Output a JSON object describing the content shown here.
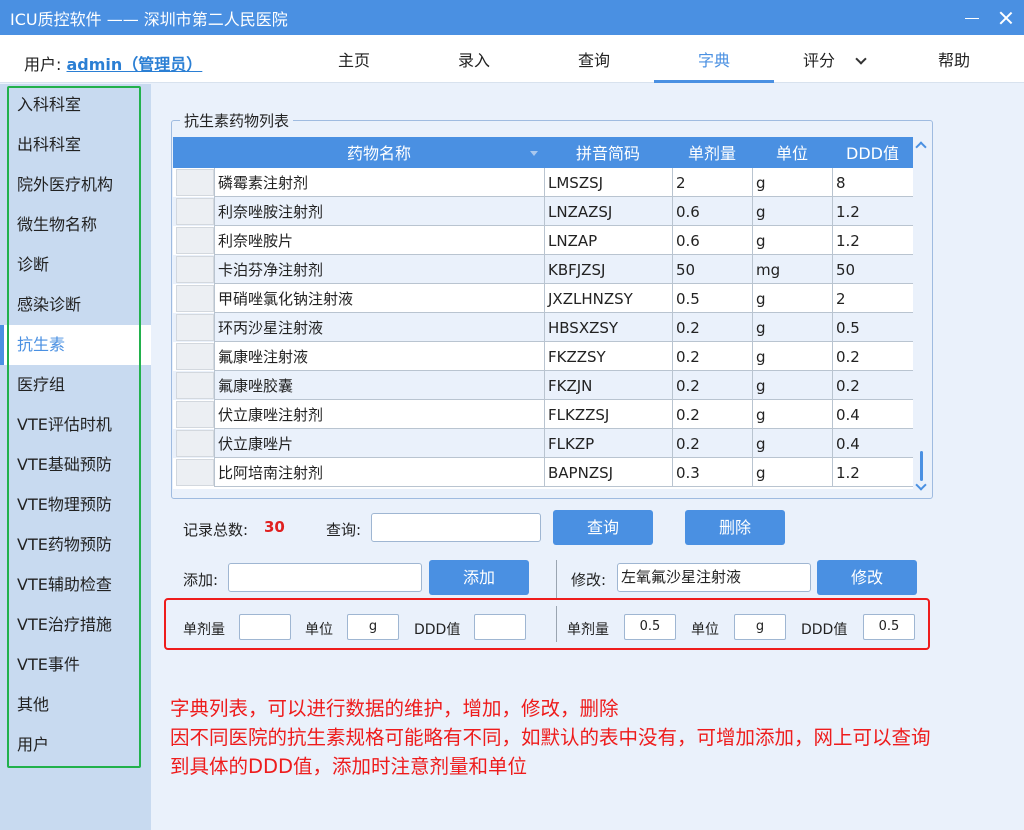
{
  "titlebar": {
    "title": "ICU质控软件 —— 深圳市第二人民医院"
  },
  "menubar": {
    "user_prefix": "用户:",
    "user_name": "admin（管理员）",
    "items": [
      {
        "label": "主页"
      },
      {
        "label": "录入"
      },
      {
        "label": "查询"
      },
      {
        "label": "字典"
      },
      {
        "label": "评分"
      },
      {
        "label": "帮助"
      }
    ],
    "active": "字典"
  },
  "sidebar": {
    "items": [
      {
        "label": "入科科室"
      },
      {
        "label": "出科科室"
      },
      {
        "label": "院外医疗机构"
      },
      {
        "label": "微生物名称"
      },
      {
        "label": "诊断"
      },
      {
        "label": "感染诊断"
      },
      {
        "label": "抗生素"
      },
      {
        "label": "医疗组"
      },
      {
        "label": "VTE评估时机"
      },
      {
        "label": "VTE基础预防"
      },
      {
        "label": "VTE物理预防"
      },
      {
        "label": "VTE药物预防"
      },
      {
        "label": "VTE辅助检查"
      },
      {
        "label": "VTE治疗措施"
      },
      {
        "label": "VTE事件"
      },
      {
        "label": "其他"
      },
      {
        "label": "用户"
      }
    ],
    "active": "抗生素",
    "frame_color": "#22b14c"
  },
  "group": {
    "title": "抗生素药物列表"
  },
  "table": {
    "columns": [
      "药物名称",
      "拼音简码",
      "单剂量",
      "单位",
      "DDD值"
    ],
    "rows": [
      [
        "磷霉素注射剂",
        "LMSZSJ",
        "2",
        "g",
        "8"
      ],
      [
        "利奈唑胺注射剂",
        "LNZAZSJ",
        "0.6",
        "g",
        "1.2"
      ],
      [
        "利奈唑胺片",
        "LNZAP",
        "0.6",
        "g",
        "1.2"
      ],
      [
        "卡泊芬净注射剂",
        "KBFJZSJ",
        "50",
        "mg",
        "50"
      ],
      [
        "甲硝唑氯化钠注射液",
        "JXZLHNZSY",
        "0.5",
        "g",
        "2"
      ],
      [
        "环丙沙星注射液",
        "HBSXZSY",
        "0.2",
        "g",
        "0.5"
      ],
      [
        "氟康唑注射液",
        "FKZZSY",
        "0.2",
        "g",
        "0.2"
      ],
      [
        "氟康唑胶囊",
        "FKZJN",
        "0.2",
        "g",
        "0.2"
      ],
      [
        "伏立康唑注射剂",
        "FLKZZSJ",
        "0.2",
        "g",
        "0.4"
      ],
      [
        "伏立康唑片",
        "FLKZP",
        "0.2",
        "g",
        "0.4"
      ],
      [
        "比阿培南注射剂",
        "BAPNZSJ",
        "0.3",
        "g",
        "1.2"
      ]
    ]
  },
  "controls": {
    "record_label": "记录总数:",
    "record_count": "30",
    "query_label": "查询:",
    "query_value": "",
    "query_button": "查询",
    "delete_button": "删除",
    "add_label": "添加:",
    "add_value": "",
    "add_button": "添加",
    "modify_label": "修改:",
    "modify_value": "左氧氟沙星注射液",
    "modify_button": "修改",
    "add_dose_label": "单剂量",
    "add_dose_value": "",
    "add_unit_label": "单位",
    "add_unit_value": "g",
    "add_ddd_label": "DDD值",
    "add_ddd_value": "",
    "mod_dose_label": "单剂量",
    "mod_dose_value": "0.5",
    "mod_unit_label": "单位",
    "mod_unit_value": "g",
    "mod_ddd_label": "DDD值",
    "mod_ddd_value": "0.5"
  },
  "notes": {
    "line1": "字典列表，可以进行数据的维护，增加，修改，删除",
    "line2": "因不同医院的抗生素规格可能略有不同，如默认的表中没有，可增加添加，网上可以查询",
    "line3": "到具体的DDD值，添加时注意剂量和单位"
  },
  "colors": {
    "accent": "#4a90e2",
    "annotation": "#ee1c1c",
    "highlight_frame": "#22b14c"
  }
}
